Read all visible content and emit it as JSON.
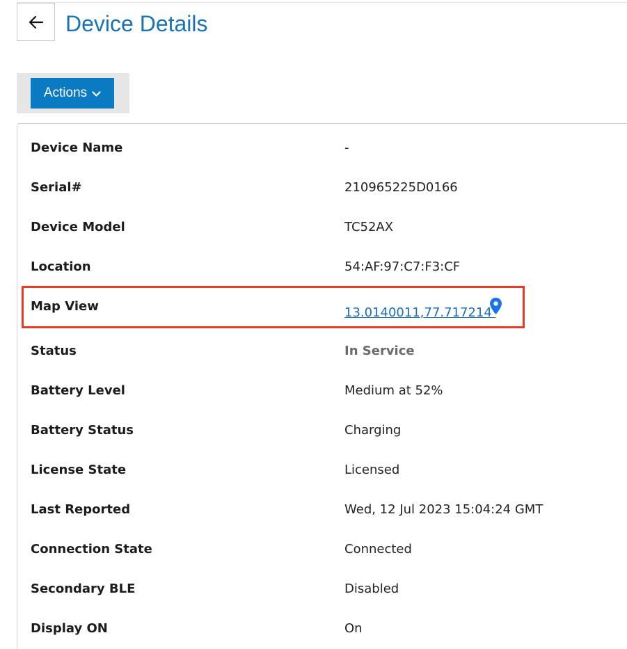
{
  "header": {
    "title": "Device Details",
    "back_icon": "arrow-left-icon"
  },
  "toolbar": {
    "actions_label": "Actions",
    "actions_icon": "chevron-down-icon",
    "accent_color": "#0a7ac3"
  },
  "details": {
    "device_name": {
      "label": "Device Name",
      "value": "-"
    },
    "serial": {
      "label": "Serial#",
      "value": "210965225D0166"
    },
    "device_model": {
      "label": "Device Model",
      "value": "TC52AX"
    },
    "location": {
      "label": "Location",
      "value": "54:AF:97:C7:F3:CF"
    },
    "map_view": {
      "label": "Map View",
      "value": "13.0140011,77.717214 ",
      "icon": "map-pin-icon"
    },
    "status": {
      "label": "Status",
      "value": "In Service"
    },
    "battery_level": {
      "label": "Battery Level",
      "value": "Medium at 52%"
    },
    "battery_status": {
      "label": "Battery Status",
      "value": "Charging"
    },
    "license_state": {
      "label": "License State",
      "value": "Licensed"
    },
    "last_reported": {
      "label": "Last Reported",
      "value": "Wed, 12 Jul 2023 15:04:24 GMT"
    },
    "connection_state": {
      "label": "Connection State",
      "value": "Connected"
    },
    "secondary_ble": {
      "label": "Secondary BLE",
      "value": "Disabled"
    },
    "display_on": {
      "label": "Display ON",
      "value": "On"
    }
  },
  "highlight": {
    "color": "#ea3a24",
    "target": "map_view"
  }
}
